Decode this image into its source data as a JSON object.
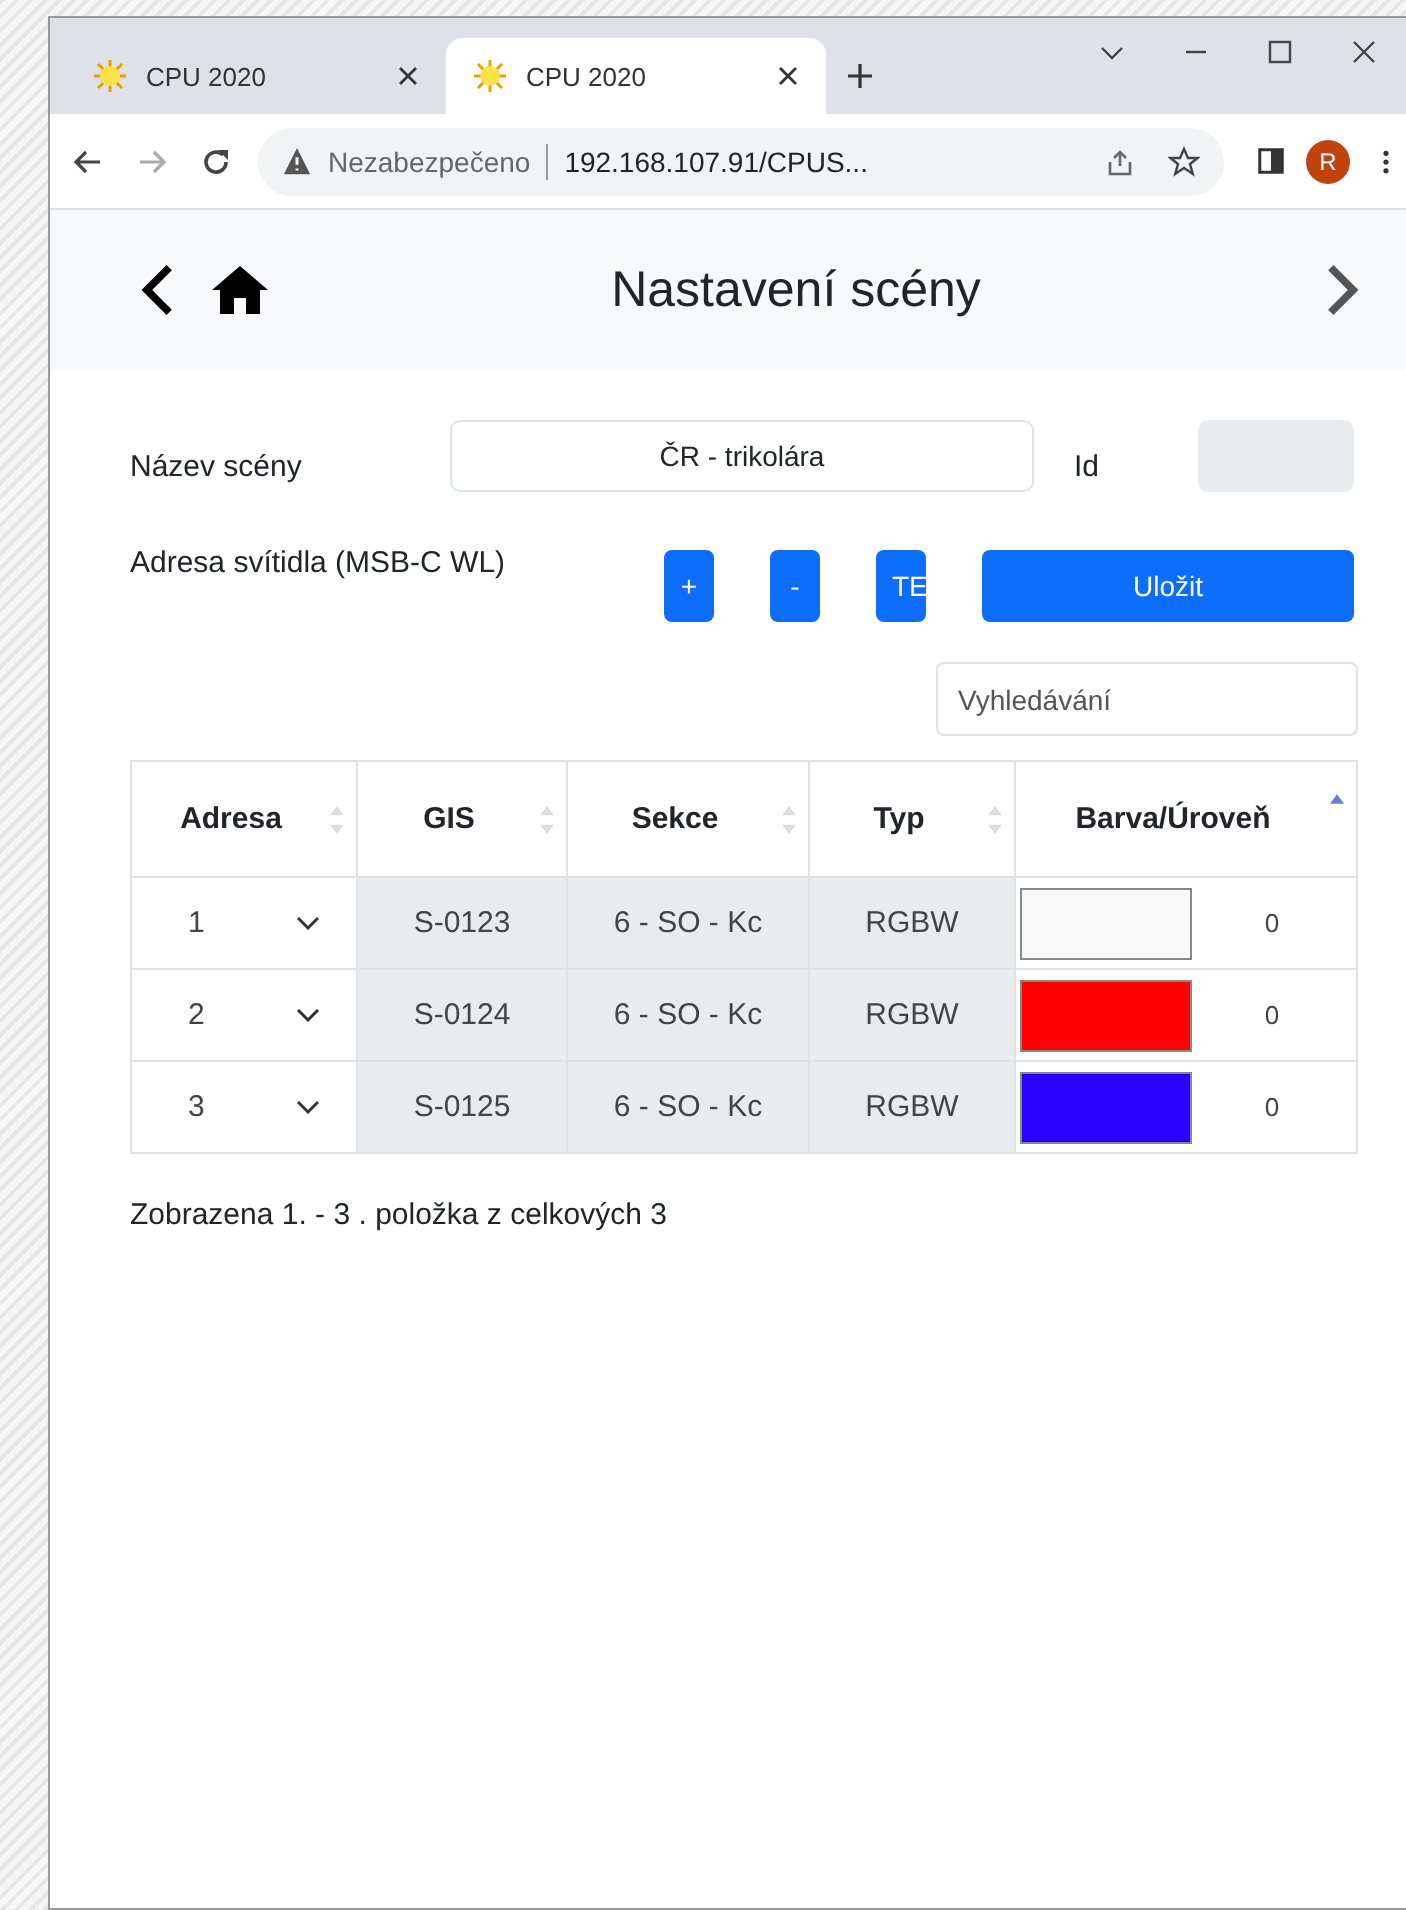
{
  "browser": {
    "tabs": [
      {
        "title": "CPU 2020",
        "selected": false
      },
      {
        "title": "CPU 2020",
        "selected": true
      }
    ],
    "security": "Nezabezpečeno",
    "url": "192.168.107.91/CPUS...",
    "profile": "R"
  },
  "header": {
    "title": "Nastavení scény"
  },
  "form": {
    "name_label": "Název scény",
    "name_value": "ČR - trikolára",
    "id_label": "Id",
    "address_label": "Adresa svítidla (MSB-C WL)",
    "buttons": [
      {
        "label": "+",
        "kind": "small"
      },
      {
        "label": "-",
        "kind": "small"
      },
      {
        "label": "TE",
        "kind": "clipped"
      },
      {
        "label": "Uložit",
        "kind": "wide"
      }
    ],
    "search": {
      "placeholder": "Vyhledávání"
    }
  },
  "table": {
    "columns": [
      {
        "label": "Adresa",
        "sorted": false
      },
      {
        "label": "GIS",
        "sorted": false
      },
      {
        "label": "Sekce",
        "sorted": false
      },
      {
        "label": "Typ",
        "sorted": false
      },
      {
        "label": "Barva/Úroveň",
        "sorted": true
      }
    ],
    "rows": [
      {
        "address": "1",
        "gis": "S-0123",
        "section": "6 - SO - Kc",
        "type": "RGBW",
        "color": "#f8f8f8",
        "level": "0"
      },
      {
        "address": "2",
        "gis": "S-0124",
        "section": "6 - SO - Kc",
        "type": "RGBW",
        "color": "#ff0000",
        "level": "0"
      },
      {
        "address": "3",
        "gis": "S-0125",
        "section": "6 - SO - Kc",
        "type": "RGBW",
        "color": "#2a00ff",
        "level": "0"
      }
    ]
  },
  "footer": "Zobrazena 1. - 3 . položka z celkových 3"
}
